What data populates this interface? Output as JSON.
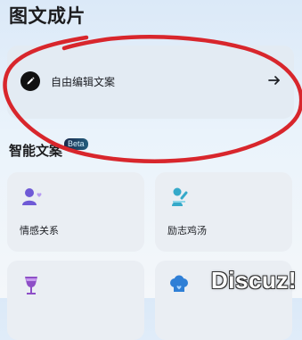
{
  "header": {
    "title": "图文成片"
  },
  "entry": {
    "label": "自由编辑文案",
    "icon": "pen-icon",
    "arrow_icon": "arrow-right-icon"
  },
  "section": {
    "title": "智能文案",
    "badge": "Beta"
  },
  "tiles": [
    {
      "label": "情感关系",
      "icon": "people-heart-icon"
    },
    {
      "label": "励志鸡汤",
      "icon": "cheering-person-icon"
    },
    {
      "label": "",
      "icon": "wine-glass-icon"
    },
    {
      "label": "",
      "icon": "chef-hat-icon"
    }
  ],
  "overlay": {
    "watermark": "Discuz!",
    "annotation_color": "#d8262c"
  }
}
